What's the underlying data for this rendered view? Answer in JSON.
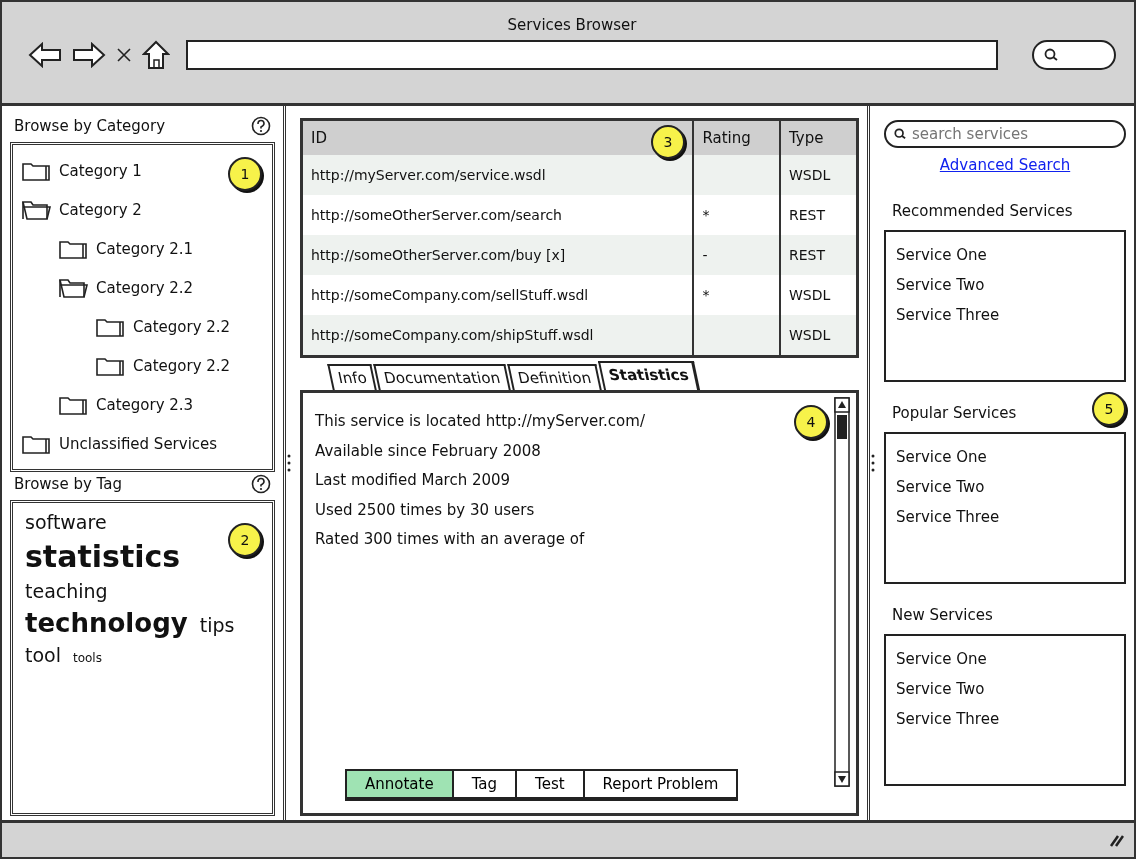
{
  "window": {
    "title": "Services Browser"
  },
  "category_panel": {
    "title": "Browse by Category",
    "callout": "1",
    "tree": [
      {
        "label": "Category 1",
        "expanded": false
      },
      {
        "label": "Category 2",
        "expanded": true,
        "children": [
          {
            "label": "Category 2.1",
            "expanded": false
          },
          {
            "label": "Category 2.2",
            "expanded": true,
            "children": [
              {
                "label": "Category 2.2",
                "expanded": false
              },
              {
                "label": "Category 2.2",
                "expanded": false
              }
            ]
          },
          {
            "label": "Category 2.3",
            "expanded": false
          }
        ]
      },
      {
        "label": "Unclassified Services",
        "expanded": false
      }
    ]
  },
  "tag_panel": {
    "title": "Browse by Tag",
    "callout": "2",
    "tag_rows": [
      [
        {
          "label": "software",
          "kind": "medium"
        }
      ],
      [
        {
          "label": "statistics",
          "kind": "xlarge"
        }
      ],
      [
        {
          "label": "teaching",
          "kind": "medium"
        }
      ],
      [
        {
          "label": "technology",
          "kind": "large"
        },
        {
          "label": "tips",
          "kind": "medium"
        }
      ],
      [
        {
          "label": "tool",
          "kind": "medium"
        },
        {
          "label": "tools",
          "kind": "small"
        }
      ]
    ]
  },
  "services_table": {
    "callout": "3",
    "columns": [
      "ID",
      "Rating",
      "Type"
    ],
    "rows": [
      {
        "id": "http://myServer.com/service.wsdl",
        "type": "WSDL"
      },
      {
        "id": "http://someOtherServer.com/search",
        "rating": "*",
        "type": "REST"
      },
      {
        "id": "http://someOtherServer.com/buy [x]",
        "rating": "-",
        "type": "REST"
      },
      {
        "id": "http://someCompany.com/sellStuff.wsdl",
        "rating": "*",
        "type": "WSDL"
      },
      {
        "id": "http://someCompany.com/shipStuff.wsdl",
        "type": "WSDL"
      }
    ]
  },
  "detail_tabs": [
    {
      "label": "Info",
      "selected": false
    },
    {
      "label": "Documentation",
      "selected": false
    },
    {
      "label": "Definition",
      "selected": false
    },
    {
      "label": "Statistics",
      "selected": true
    }
  ],
  "detail": {
    "callout": "4",
    "lines": [
      "This service is located http://myServer.com/",
      "Available since February 2008",
      "Last modified March 2009",
      "Used 2500 times by 30 users",
      "Rated 300 times with an average of"
    ],
    "actions": [
      {
        "label": "Annotate",
        "selected": true
      },
      {
        "label": "Tag",
        "selected": false
      },
      {
        "label": "Test",
        "selected": false
      },
      {
        "label": "Report Problem",
        "selected": false
      }
    ]
  },
  "right_panel": {
    "search": {
      "placeholder": "search services"
    },
    "advanced_link": "Advanced Search",
    "lists": [
      {
        "title": "Recommended Services",
        "items": [
          "Service One",
          "Service Two",
          "Service Three"
        ]
      },
      {
        "title": "Popular Services",
        "callout": "5",
        "items": [
          "Service One",
          "Service Two",
          "Service Three"
        ]
      },
      {
        "title": "New Services",
        "items": [
          "Service One",
          "Service Two",
          "Service Three"
        ]
      }
    ]
  }
}
